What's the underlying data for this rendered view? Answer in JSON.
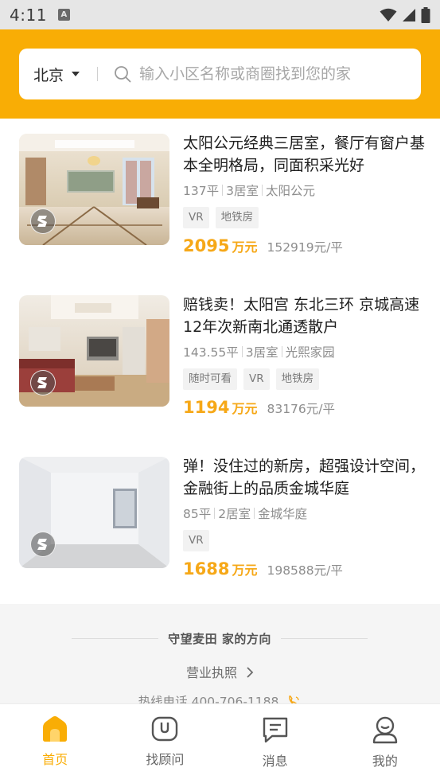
{
  "status_bar": {
    "time": "4:11",
    "notification_icon": "A"
  },
  "search": {
    "city": "北京",
    "placeholder": "输入小区名称或商圈找到您的家"
  },
  "listings": [
    {
      "title": "太阳公元经典三居室，餐厅有窗户基本全明格局，同面积采光好",
      "area": "137平",
      "rooms": "3居室",
      "community": "太阳公元",
      "tags": [
        "VR",
        "地铁房"
      ],
      "price": "2095",
      "price_unit": "万元",
      "unit_price": "152919元/平"
    },
    {
      "title": "赔钱卖！太阳宫 东北三环 京城高速 12年次新南北通透散户",
      "area": "143.55平",
      "rooms": "3居室",
      "community": "光熙家园",
      "tags": [
        "随时可看",
        "VR",
        "地铁房"
      ],
      "price": "1194",
      "price_unit": "万元",
      "unit_price": "83176元/平"
    },
    {
      "title": "弹！没住过的新房，超强设计空间，金融街上的品质金城华庭",
      "area": "85平",
      "rooms": "2居室",
      "community": "金城华庭",
      "tags": [
        "VR"
      ],
      "price": "1688",
      "price_unit": "万元",
      "unit_price": "198588元/平"
    }
  ],
  "footer": {
    "slogan": "守望麦田 家的方向",
    "license": "营业执照",
    "hotline": "热线电话 400-706-1188"
  },
  "tabbar": {
    "items": [
      {
        "label": "首页",
        "icon": "home-icon",
        "active": true
      },
      {
        "label": "找顾问",
        "icon": "consultant-icon",
        "active": false
      },
      {
        "label": "消息",
        "icon": "message-icon",
        "active": false
      },
      {
        "label": "我的",
        "icon": "profile-icon",
        "active": false
      }
    ]
  },
  "colors": {
    "brand": "#f9ad05",
    "price": "#f6a818"
  }
}
